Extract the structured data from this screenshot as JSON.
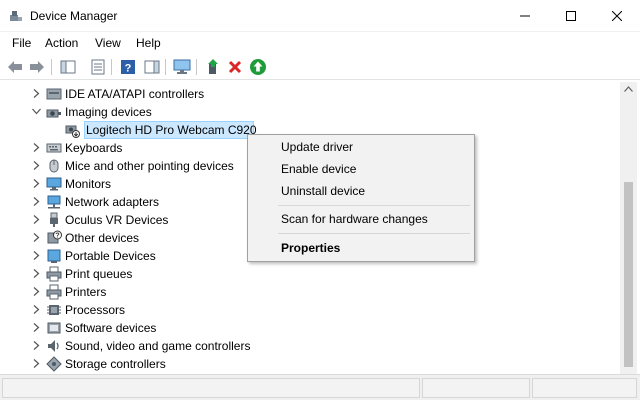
{
  "window": {
    "title": "Device Manager"
  },
  "menu": [
    "File",
    "Action",
    "View",
    "Help"
  ],
  "toolbar": {
    "buttons": [
      "back-icon",
      "forward-icon",
      "show-hide-console-tree-icon",
      "properties-icon",
      "help-icon",
      "action-pane-icon",
      "monitor-icon",
      "update-driver-icon",
      "uninstall-icon",
      "enable-device-icon"
    ]
  },
  "tree": {
    "items": [
      {
        "label": "IDE ATA/ATAPI controllers",
        "icon": "ide-icon",
        "expanded": false
      },
      {
        "label": "Imaging devices",
        "icon": "camera-icon",
        "expanded": true
      },
      {
        "label": "Logitech HD Pro Webcam C920",
        "icon": "webcam-disabled-icon",
        "child": true,
        "selected": true
      },
      {
        "label": "Keyboards",
        "icon": "keyboard-icon",
        "expanded": false
      },
      {
        "label": "Mice and other pointing devices",
        "icon": "mouse-icon",
        "expanded": false
      },
      {
        "label": "Monitors",
        "icon": "monitor-icon",
        "expanded": false
      },
      {
        "label": "Network adapters",
        "icon": "network-icon",
        "expanded": false
      },
      {
        "label": "Oculus VR Devices",
        "icon": "usb-icon",
        "expanded": false
      },
      {
        "label": "Other devices",
        "icon": "unknown-device-icon",
        "expanded": false
      },
      {
        "label": "Portable Devices",
        "icon": "portable-device-icon",
        "expanded": false
      },
      {
        "label": "Print queues",
        "icon": "printer-icon",
        "expanded": false
      },
      {
        "label": "Printers",
        "icon": "printer-icon",
        "expanded": false
      },
      {
        "label": "Processors",
        "icon": "processor-icon",
        "expanded": false
      },
      {
        "label": "Software devices",
        "icon": "software-device-icon",
        "expanded": false
      },
      {
        "label": "Sound, video and game controllers",
        "icon": "speaker-icon",
        "expanded": false
      },
      {
        "label": "Storage controllers",
        "icon": "storage-icon",
        "expanded": false
      }
    ]
  },
  "context_menu": {
    "items": [
      {
        "label": "Update driver",
        "bold": false
      },
      {
        "label": "Enable device",
        "bold": false
      },
      {
        "label": "Uninstall device",
        "bold": false
      },
      {
        "label": "Scan for hardware changes",
        "bold": false
      },
      {
        "label": "Properties",
        "bold": true
      }
    ]
  },
  "colors": {
    "selection_bg": "#cce8ff",
    "selection_border": "#99d1ff",
    "menu_bg": "#f2f2f2"
  }
}
